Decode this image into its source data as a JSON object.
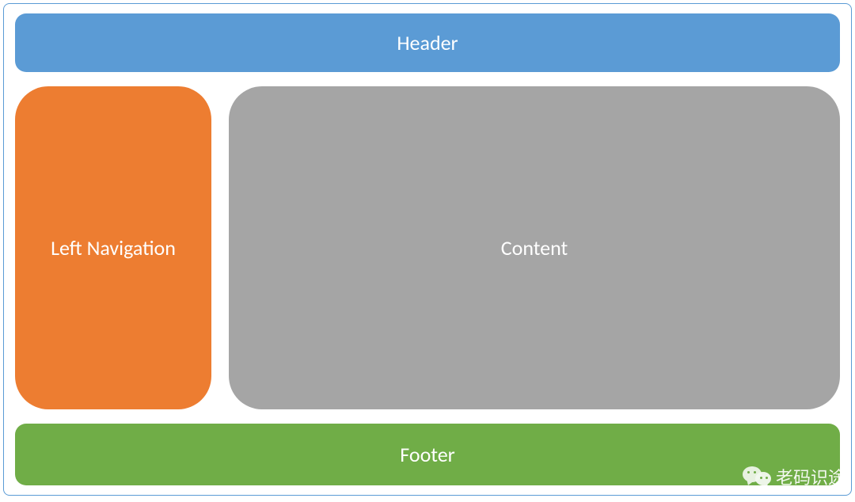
{
  "layout": {
    "header": {
      "label": "Header"
    },
    "left_nav": {
      "label": "Left Navigation"
    },
    "content": {
      "label": "Content"
    },
    "footer": {
      "label": "Footer"
    }
  },
  "watermark": {
    "text": "老码识途"
  },
  "colors": {
    "header": "#5b9bd5",
    "left_nav": "#ed7d31",
    "content": "#a5a5a5",
    "footer": "#70ad47",
    "container_border": "#5b9bd5"
  }
}
